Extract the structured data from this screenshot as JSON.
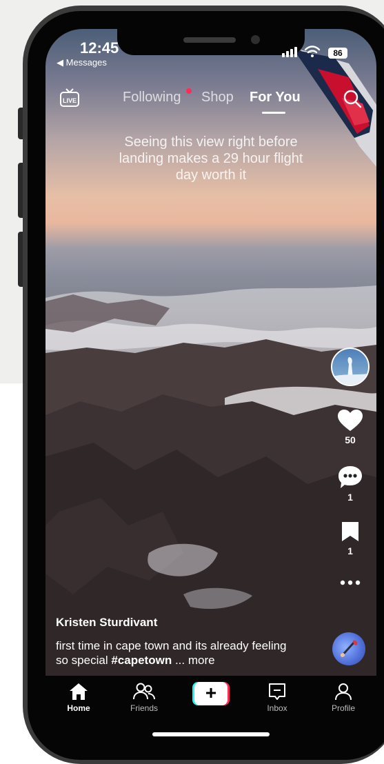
{
  "status_bar": {
    "time": "12:45",
    "back_label": "◀ Messages",
    "battery": "86"
  },
  "top_nav": {
    "live_label": "LIVE",
    "tabs": [
      {
        "label": "Following",
        "has_notification": true
      },
      {
        "label": "Shop"
      },
      {
        "label": "For You",
        "active": true
      }
    ]
  },
  "video": {
    "caption": "Seeing this view right before landing makes a 29 hour flight day worth it",
    "author": "Kristen Sturdivant",
    "description": "first time in cape town and its already feeling so special",
    "hashtag": "#capetown",
    "more_label": "... more"
  },
  "actions": {
    "likes": "50",
    "comments": "1",
    "saves": "1"
  },
  "bottom_nav": [
    {
      "label": "Home",
      "icon": "home-icon",
      "active": true
    },
    {
      "label": "Friends",
      "icon": "friends-icon"
    },
    {
      "label": "",
      "icon": "create-icon"
    },
    {
      "label": "Inbox",
      "icon": "inbox-icon"
    },
    {
      "label": "Profile",
      "icon": "profile-icon"
    }
  ],
  "colors": {
    "accent_red": "#fe2c55",
    "accent_cyan": "#25f4ee",
    "nav_bg": "#050505"
  }
}
